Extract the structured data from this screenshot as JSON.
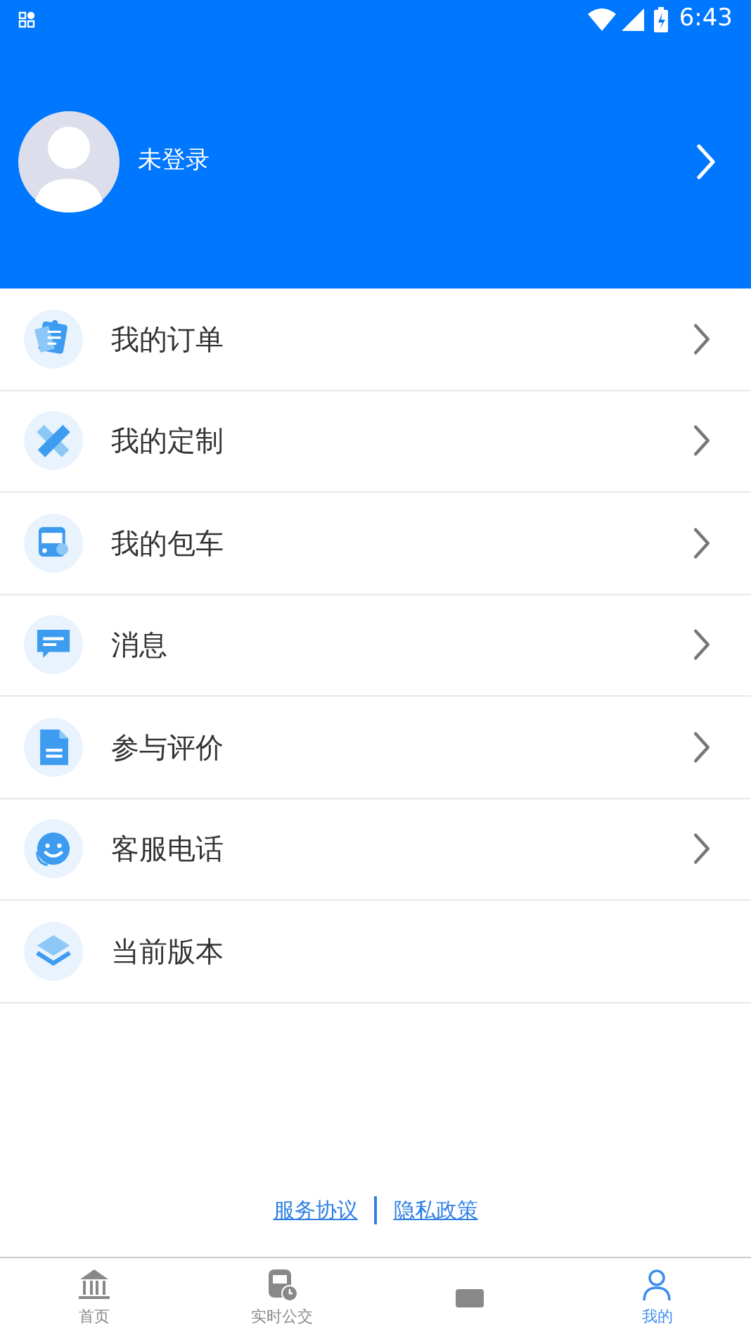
{
  "status_bar": {
    "time": "6:43"
  },
  "profile": {
    "name": "未登录"
  },
  "menu": [
    {
      "label": "我的订单",
      "chevron": true
    },
    {
      "label": "我的定制",
      "chevron": true
    },
    {
      "label": "我的包车",
      "chevron": true
    },
    {
      "label": "消息",
      "chevron": true
    },
    {
      "label": "参与评价",
      "chevron": true
    },
    {
      "label": "客服电话",
      "chevron": true
    },
    {
      "label": "当前版本",
      "chevron": false
    }
  ],
  "footer_links": [
    "服务协议",
    "隐私政策"
  ],
  "bottom_nav": [
    {
      "label": "首页",
      "selected": false
    },
    {
      "label": "实时公交",
      "selected": false
    },
    {
      "selected": false
    },
    {
      "label": "我的",
      "selected": true
    }
  ]
}
